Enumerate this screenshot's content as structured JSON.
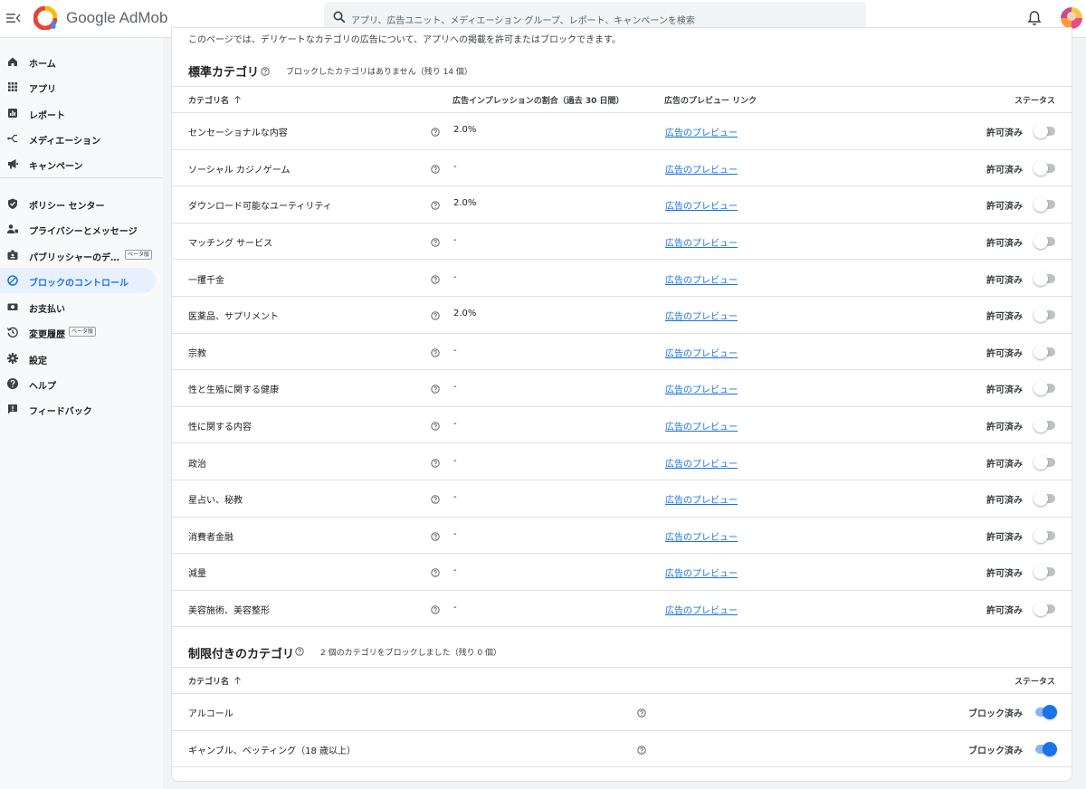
{
  "app": {
    "brand": "Google AdMob"
  },
  "search": {
    "placeholder": "アプリ、広告ユニット、メディエーション グループ、レポート、キャンペーンを検索"
  },
  "sidebar": {
    "items": [
      {
        "id": "home",
        "label": "ホーム",
        "icon": "home-icon"
      },
      {
        "id": "apps",
        "label": "アプリ",
        "icon": "apps-grid-icon"
      },
      {
        "id": "reports",
        "label": "レポート",
        "icon": "bar-chart-icon"
      },
      {
        "id": "mediation",
        "label": "メディエーション",
        "icon": "mediation-icon"
      },
      {
        "id": "campaigns",
        "label": "キャンペーン",
        "icon": "megaphone-icon"
      },
      {
        "id": "policy",
        "label": "ポリシー センター",
        "icon": "shield-check-icon"
      },
      {
        "id": "privacy",
        "label": "プライバシーとメッセージ",
        "icon": "person-privacy-icon"
      },
      {
        "id": "publisher",
        "label": "パブリッシャーのデ…",
        "icon": "id-badge-icon",
        "badge": "ベータ版"
      },
      {
        "id": "blocking",
        "label": "ブロックのコントロール",
        "icon": "block-icon",
        "active": true
      },
      {
        "id": "payments",
        "label": "お支払い",
        "icon": "payments-icon"
      },
      {
        "id": "history",
        "label": "変更履歴",
        "icon": "history-icon",
        "badge": "ベータ版"
      },
      {
        "id": "settings",
        "label": "設定",
        "icon": "gear-icon"
      },
      {
        "id": "help",
        "label": "ヘルプ",
        "icon": "help-circle-icon"
      },
      {
        "id": "feedback",
        "label": "フィードバック",
        "icon": "feedback-icon"
      }
    ]
  },
  "page": {
    "cutoff_text": "このページでは、デリケートなカテゴリの広告について、アプリへの掲載を許可またはブロックできます。"
  },
  "standard": {
    "title": "標準カテゴリ",
    "subtitle": "ブロックしたカテゴリはありません（残り 14 個）",
    "columns": {
      "name": "カテゴリ名",
      "share": "広告インプレッションの割合（過去 30 日間）",
      "preview": "広告のプレビュー リンク",
      "status": "ステータス"
    },
    "rows": [
      {
        "name": "センセーショナルな内容",
        "share": "2.0%",
        "preview": "広告のプレビュー",
        "status": "許可済み"
      },
      {
        "name": "ソーシャル カジノゲーム",
        "share": "-",
        "preview": "広告のプレビュー",
        "status": "許可済み"
      },
      {
        "name": "ダウンロード可能なユーティリティ",
        "share": "2.0%",
        "preview": "広告のプレビュー",
        "status": "許可済み"
      },
      {
        "name": "マッチング サービス",
        "share": "-",
        "preview": "広告のプレビュー",
        "status": "許可済み"
      },
      {
        "name": "一攫千金",
        "share": "-",
        "preview": "広告のプレビュー",
        "status": "許可済み"
      },
      {
        "name": "医薬品、サプリメント",
        "share": "2.0%",
        "preview": "広告のプレビュー",
        "status": "許可済み"
      },
      {
        "name": "宗教",
        "share": "-",
        "preview": "広告のプレビュー",
        "status": "許可済み"
      },
      {
        "name": "性と生殖に関する健康",
        "share": "-",
        "preview": "広告のプレビュー",
        "status": "許可済み"
      },
      {
        "name": "性に関する内容",
        "share": "-",
        "preview": "広告のプレビュー",
        "status": "許可済み"
      },
      {
        "name": "政治",
        "share": "-",
        "preview": "広告のプレビュー",
        "status": "許可済み"
      },
      {
        "name": "星占い、秘教",
        "share": "-",
        "preview": "広告のプレビュー",
        "status": "許可済み"
      },
      {
        "name": "消費者金融",
        "share": "-",
        "preview": "広告のプレビュー",
        "status": "許可済み"
      },
      {
        "name": "減量",
        "share": "-",
        "preview": "広告のプレビュー",
        "status": "許可済み"
      },
      {
        "name": "美容施術、美容整形",
        "share": "-",
        "preview": "広告のプレビュー",
        "status": "許可済み"
      }
    ]
  },
  "restricted": {
    "title": "制限付きのカテゴリ",
    "subtitle": "2 個のカテゴリをブロックしました（残り 0 個）",
    "columns": {
      "name": "カテゴリ名",
      "status": "ステータス"
    },
    "rows": [
      {
        "name": "アルコール",
        "status": "ブロック済み",
        "blocked": true
      },
      {
        "name": "ギャンブル、ベッティング（18 歳以上）",
        "status": "ブロック済み",
        "blocked": true
      }
    ]
  },
  "colors": {
    "accent": "#1a73e8",
    "active_nav_bg": "#e8f0fe",
    "toggle_on_track": "#8ab4f8",
    "toggle_off_track": "#bdc1c6"
  }
}
